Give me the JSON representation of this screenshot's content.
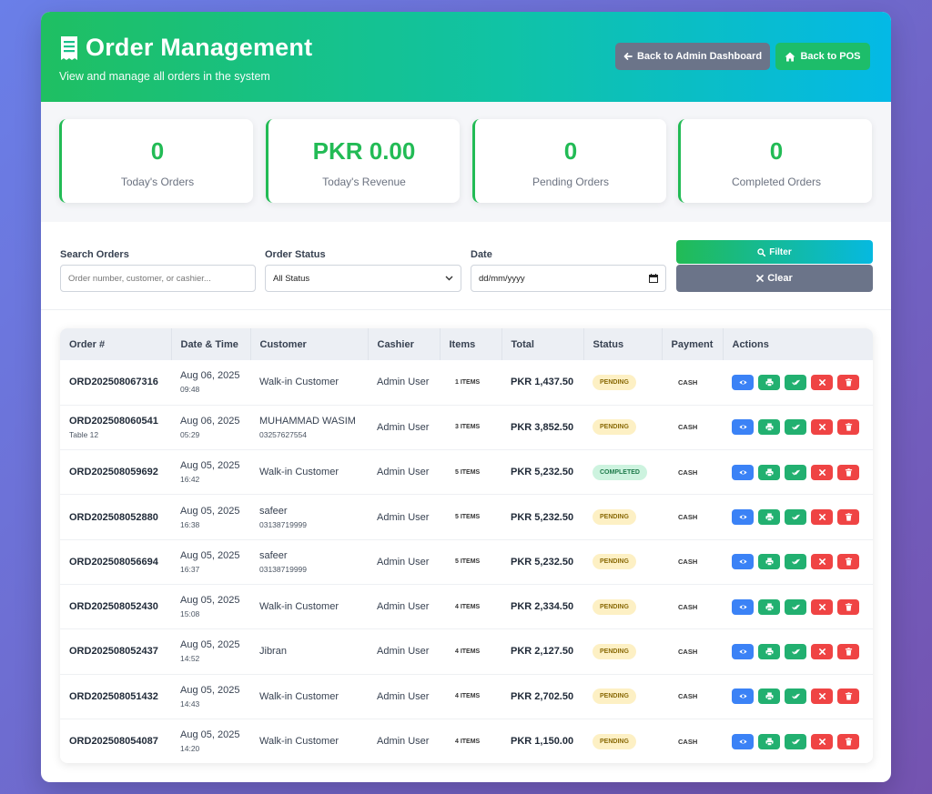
{
  "header": {
    "title": "Order Management",
    "subtitle": "View and manage all orders in the system",
    "back_admin_label": "Back to Admin Dashboard",
    "back_pos_label": "Back to POS"
  },
  "stats": [
    {
      "value": "0",
      "label": "Today's Orders"
    },
    {
      "value": "PKR 0.00",
      "label": "Today's Revenue"
    },
    {
      "value": "0",
      "label": "Pending Orders"
    },
    {
      "value": "0",
      "label": "Completed Orders"
    }
  ],
  "filters": {
    "search_label": "Search Orders",
    "search_placeholder": "Order number, customer, or cashier...",
    "status_label": "Order Status",
    "status_value": "All Status",
    "date_label": "Date",
    "date_placeholder": "dd/mm/yyyy",
    "filter_button": "Filter",
    "clear_button": "Clear"
  },
  "table": {
    "columns": [
      "Order #",
      "Date & Time",
      "Customer",
      "Cashier",
      "Items",
      "Total",
      "Status",
      "Payment",
      "Actions"
    ],
    "rows": [
      {
        "order": "ORD202508067316",
        "order_sub": "",
        "date": "Aug 06, 2025",
        "time": "09:48",
        "customer": "Walk-in Customer",
        "customer_sub": "",
        "cashier": "Admin User",
        "items": "1 ITEMS",
        "total": "PKR 1,437.50",
        "status": "PENDING",
        "payment": "CASH"
      },
      {
        "order": "ORD202508060541",
        "order_sub": "Table 12",
        "date": "Aug 06, 2025",
        "time": "05:29",
        "customer": "MUHAMMAD WASIM",
        "customer_sub": "03257627554",
        "cashier": "Admin User",
        "items": "3 ITEMS",
        "total": "PKR 3,852.50",
        "status": "PENDING",
        "payment": "CASH"
      },
      {
        "order": "ORD202508059692",
        "order_sub": "",
        "date": "Aug 05, 2025",
        "time": "16:42",
        "customer": "Walk-in Customer",
        "customer_sub": "",
        "cashier": "Admin User",
        "items": "5 ITEMS",
        "total": "PKR 5,232.50",
        "status": "COMPLETED",
        "payment": "CASH"
      },
      {
        "order": "ORD202508052880",
        "order_sub": "",
        "date": "Aug 05, 2025",
        "time": "16:38",
        "customer": "safeer",
        "customer_sub": "03138719999",
        "cashier": "Admin User",
        "items": "5 ITEMS",
        "total": "PKR 5,232.50",
        "status": "PENDING",
        "payment": "CASH"
      },
      {
        "order": "ORD202508056694",
        "order_sub": "",
        "date": "Aug 05, 2025",
        "time": "16:37",
        "customer": "safeer",
        "customer_sub": "03138719999",
        "cashier": "Admin User",
        "items": "5 ITEMS",
        "total": "PKR 5,232.50",
        "status": "PENDING",
        "payment": "CASH"
      },
      {
        "order": "ORD202508052430",
        "order_sub": "",
        "date": "Aug 05, 2025",
        "time": "15:08",
        "customer": "Walk-in Customer",
        "customer_sub": "",
        "cashier": "Admin User",
        "items": "4 ITEMS",
        "total": "PKR 2,334.50",
        "status": "PENDING",
        "payment": "CASH"
      },
      {
        "order": "ORD202508052437",
        "order_sub": "",
        "date": "Aug 05, 2025",
        "time": "14:52",
        "customer": "Jibran",
        "customer_sub": "",
        "cashier": "Admin User",
        "items": "4 ITEMS",
        "total": "PKR 2,127.50",
        "status": "PENDING",
        "payment": "CASH"
      },
      {
        "order": "ORD202508051432",
        "order_sub": "",
        "date": "Aug 05, 2025",
        "time": "14:43",
        "customer": "Walk-in Customer",
        "customer_sub": "",
        "cashier": "Admin User",
        "items": "4 ITEMS",
        "total": "PKR 2,702.50",
        "status": "PENDING",
        "payment": "CASH"
      },
      {
        "order": "ORD202508054087",
        "order_sub": "",
        "date": "Aug 05, 2025",
        "time": "14:20",
        "customer": "Walk-in Customer",
        "customer_sub": "",
        "cashier": "Admin User",
        "items": "4 ITEMS",
        "total": "PKR 1,150.00",
        "status": "PENDING",
        "payment": "CASH"
      }
    ],
    "row_actions": [
      "eye-icon",
      "printer-icon",
      "check-double-icon",
      "x-icon",
      "trash-icon"
    ]
  },
  "colors": {
    "accent_green": "#22bb55",
    "accent_cyan": "#04b9e6",
    "pending_bg": "#fdf0c4",
    "completed_bg": "#cdf3df",
    "view_blue": "#3b82f6",
    "danger_red": "#ef4444"
  }
}
